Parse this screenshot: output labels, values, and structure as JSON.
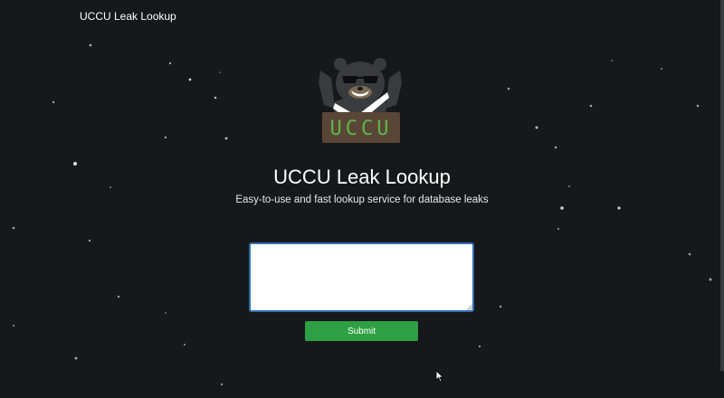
{
  "nav": {
    "title": "UCCU Leak Lookup"
  },
  "logo": {
    "label": "UCCU"
  },
  "hero": {
    "title": "UCCU Leak Lookup",
    "subtitle": "Easy-to-use and fast lookup service for database leaks"
  },
  "form": {
    "query_value": "",
    "submit_label": "Submit"
  },
  "colors": {
    "background": "#17181b",
    "submit_button": "#2ea043",
    "textarea_focus_border": "#2f6fb0",
    "logo_text": "#5ab84a"
  },
  "icons": {
    "mascot": "bear-mascot-logo",
    "cursor": "mouse-pointer-icon"
  }
}
